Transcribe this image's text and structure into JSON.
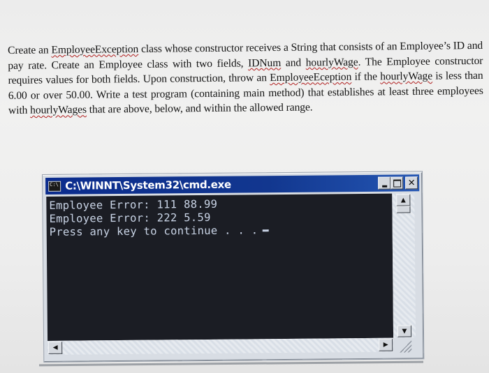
{
  "problem": {
    "segments": [
      {
        "text": "Create an ",
        "flag": false
      },
      {
        "text": "EmployeeException",
        "flag": true
      },
      {
        "text": " class whose constructor receives a String that consists of an Employee’s ID and pay rate.  Create an Employee class with two fields, ",
        "flag": false
      },
      {
        "text": "IDNum",
        "flag": true
      },
      {
        "text": " and ",
        "flag": false
      },
      {
        "text": "hourlyWage",
        "flag": true
      },
      {
        "text": ".  The Employee constructor requires values for both fields.  Upon construction, throw an ",
        "flag": false
      },
      {
        "text": "EmployeeEception",
        "flag": true
      },
      {
        "text": " if the ",
        "flag": false
      },
      {
        "text": "hourlyWage",
        "flag": true
      },
      {
        "text": " is less than 6.00 or over 50.00.  Write a test program (containing main method) that establishes at least three employees with ",
        "flag": false
      },
      {
        "text": "hourlyWages",
        "flag": true
      },
      {
        "text": " that are above, below, and within the allowed range.",
        "flag": false
      }
    ]
  },
  "window": {
    "title": "C:\\WINNT\\System32\\cmd.exe",
    "icon_label": "C:\\",
    "buttons": {
      "minimize": "minimize",
      "maximize": "maximize",
      "close": "✕"
    }
  },
  "console": {
    "lines": [
      "Employee Error: 111 88.99",
      "Employee Error: 222 5.59",
      "Press any key to continue . . ."
    ]
  },
  "scrollbars": {
    "up": "▲",
    "down": "▼",
    "left": "◀",
    "right": "▶"
  },
  "colors": {
    "titlebar": "#0b2c8e",
    "console_bg": "#1b1d24",
    "console_fg": "#c9d4e6",
    "spell_underline": "#b01e1e"
  }
}
